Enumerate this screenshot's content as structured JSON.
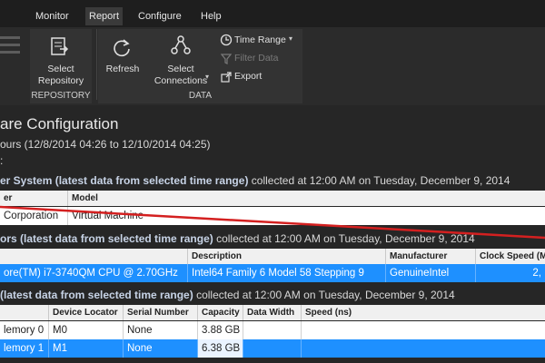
{
  "menu": {
    "items": [
      "Monitor",
      "Report",
      "Configure",
      "Help"
    ],
    "active": "Report"
  },
  "ribbon": {
    "select_repository": "Select\nRepository",
    "repository_group": "REPOSITORY",
    "refresh": "Refresh",
    "select_connections": "Select\nConnections",
    "time_range": "Time Range",
    "filter_data": "Filter Data",
    "export": "Export",
    "data_group": "DATA"
  },
  "report": {
    "title": "are Configuration",
    "subtitle": "ours (12/8/2014 04:26 to 12/10/2014 04:25)",
    "colon_line": ":",
    "system_section": {
      "heading_bold": "er System (latest data from selected time range)",
      "heading_rest": " collected at 12:00 AM on Tuesday, December 9, 2014",
      "columns": [
        "er",
        "Model"
      ],
      "row": [
        "Corporation",
        "Virtual Machine"
      ]
    },
    "processor_section": {
      "heading_bold": "ors (latest data from selected time range)",
      "heading_rest": " collected at 12:00 AM on Tuesday, December 9, 2014",
      "columns": [
        "",
        "Description",
        "Manufacturer",
        "Clock Speed (M"
      ],
      "row": [
        "ore(TM) i7-3740QM CPU @ 2.70GHz",
        "Intel64 Family 6 Model 58 Stepping 9",
        "GenuineIntel",
        "2,"
      ]
    },
    "memory_section": {
      "heading_bold": "(latest data from selected time range)",
      "heading_rest": " collected at 12:00 AM on Tuesday, December 9, 2014",
      "columns": [
        "",
        "Device Locator",
        "Serial Number",
        "Capacity",
        "Data Width",
        "Speed (ns)"
      ],
      "rows": [
        [
          "lemory 0",
          "M0",
          "None",
          "3.88 GB",
          "",
          ""
        ],
        [
          "lemory 1",
          "M1",
          "None",
          "6.38 GB",
          "",
          ""
        ]
      ]
    }
  },
  "colors": {
    "selected_row": "#1e90ff",
    "annotation_line": "#d42020",
    "heading_bold": "#c7d3e6"
  }
}
